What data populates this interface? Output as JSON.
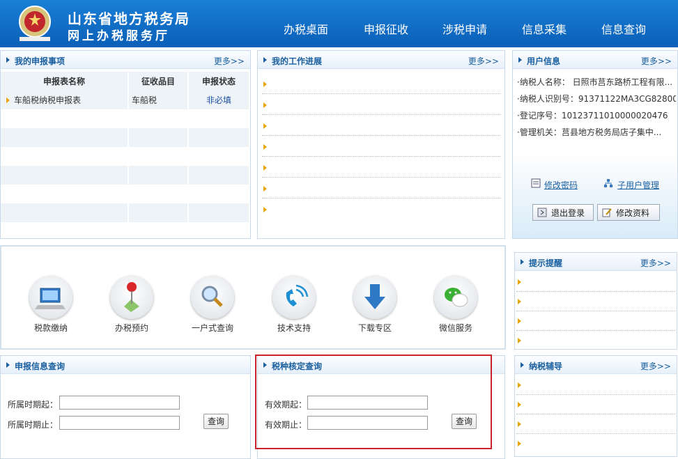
{
  "header": {
    "title_line1": "山东省地方税务局",
    "title_line2": "网上办税服务厅",
    "nav": [
      "办税桌面",
      "申报征收",
      "涉税申请",
      "信息采集",
      "信息查询"
    ]
  },
  "my_declarations": {
    "title": "我的申报事项",
    "more": "更多>>",
    "columns": [
      "申报表名称",
      "征收品目",
      "申报状态"
    ],
    "rows": [
      {
        "name": "车船税纳税申报表",
        "item": "车船税",
        "status": "非必填"
      }
    ]
  },
  "my_progress": {
    "title": "我的工作进展",
    "more": "更多>>"
  },
  "user_info": {
    "title": "用户信息",
    "more": "更多>>",
    "taxpayer_name": "·纳税人名称： 日照市莒东路桥工程有限...",
    "taxpayer_id": "·纳税人识别号：91371122MA3CG82800",
    "reg_no": "·登记序号：10123711010000020476",
    "authority": "·管理机关：莒县地方税务局店子集中...",
    "change_password": "修改密码",
    "sub_user_mgmt": "子用户管理",
    "logout": "退出登录",
    "edit_profile": "修改资料"
  },
  "quick_links": [
    "税款缴纳",
    "办税预约",
    "一户式查询",
    "技术支持",
    "下载专区",
    "微信服务"
  ],
  "reminders": {
    "title": "提示提醒",
    "more": "更多>>"
  },
  "guidance": {
    "title": "纳税辅导",
    "more": "更多>>"
  },
  "decl_query": {
    "title": "申报信息查询",
    "start_label": "所属时期起：",
    "end_label": "所属时期止：",
    "button": "查询"
  },
  "tax_type_query": {
    "title": "税种核定查询",
    "start_label": "有效期起：",
    "end_label": "有效期止：",
    "button": "查询"
  },
  "colors": {
    "header": "#0b5fb7",
    "panel_title": "#1a5fa0",
    "highlight_box": "#c8232b"
  }
}
